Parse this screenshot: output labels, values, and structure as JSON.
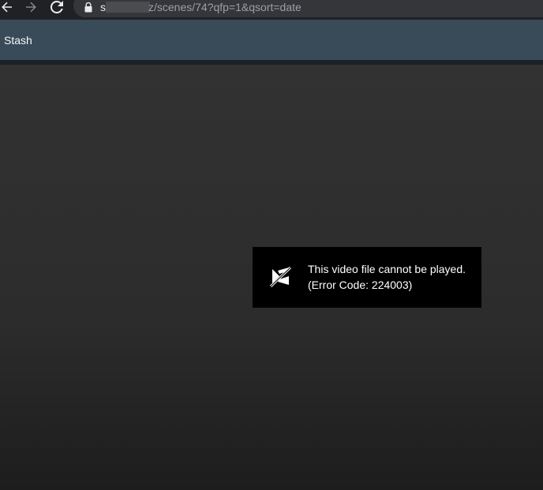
{
  "browser": {
    "url_prefix": "s",
    "url_path": "z/scenes/74?qfp=1&qsort=date",
    "back_icon": "arrow-left-icon",
    "forward_icon": "arrow-right-icon",
    "reload_icon": "reload-icon",
    "lock_icon": "lock-icon"
  },
  "app": {
    "brand": "Stash",
    "navbar_color": "#394b59"
  },
  "player": {
    "error_line1": "This video file cannot be played.",
    "error_line2": "(Error Code: 224003)",
    "error_icon": "video-off-icon"
  }
}
